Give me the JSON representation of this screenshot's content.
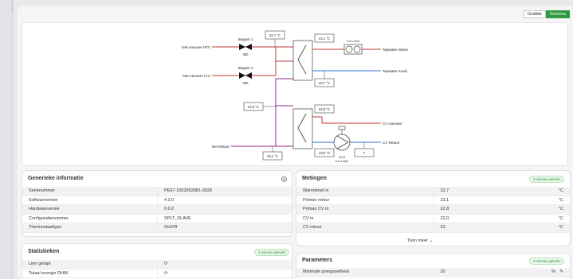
{
  "view_toggle": {
    "graph_label": "Grafiek",
    "schema_label": "Schema"
  },
  "schema": {
    "labels": {
      "net_aanvoer_htv": "Net Aanvoer HTV",
      "net_aanvoer_ltv": "Net Aanvoer LTV",
      "net_retour": "Net Retour",
      "stepper1": "Stepper 1",
      "stepper1_val": "400",
      "stepper2": "Stepper 2",
      "stepper2_val": "400",
      "tapwater_warm": "Tapwater Warm",
      "tapwater_koud": "Tapwater Koud",
      "cv_aanvoer": "CV Aanvoer",
      "cv_retour": "CV Retour",
      "flow_dhw": "0.0 L/min",
      "pump_flow_a": "10,0",
      "pump_flow_b": "0.0 L/min",
      "unknown": "?"
    },
    "temps": {
      "top_in": "22,7 °C",
      "tap_warm": "22,1 °C",
      "tap_cold": "22,7 °C",
      "mid_left": "22,8 °C",
      "cv_supply": "22,8 °C",
      "pump_temp": "23,0 °C",
      "bottom": "23,1 °C"
    }
  },
  "generic_info": {
    "title": "Generieke informatie",
    "rows": [
      {
        "key": "Serienummer",
        "value": "PE67-1003052881-0029"
      },
      {
        "key": "Softwareversie",
        "value": "4.3.0"
      },
      {
        "key": "Hardwareversie",
        "value": "0.0.2"
      },
      {
        "key": "Configuratienummer",
        "value": "SPLT_SLAVE"
      },
      {
        "key": "Thermostaattype",
        "value": "On/Off"
      }
    ]
  },
  "statistics": {
    "title": "Statistieken",
    "badge": "3 minuten geleden",
    "rows": [
      {
        "key": "Liter getapt",
        "value": "⟳"
      },
      {
        "key": "Totaal energie DHW",
        "value": "⟳"
      }
    ]
  },
  "measurements": {
    "title": "Metingen",
    "badge": "3 minuten geleden",
    "rows": [
      {
        "key": "Warmtenet in",
        "value": "22,7",
        "unit": "°C"
      },
      {
        "key": "Primair retour",
        "value": "23,1",
        "unit": "°C"
      },
      {
        "key": "Primair CV in",
        "value": "22,8",
        "unit": "°C"
      },
      {
        "key": "CV in",
        "value": "22,0",
        "unit": "°C"
      },
      {
        "key": "CV retour",
        "value": "23",
        "unit": "°C"
      }
    ],
    "more": "Toon meer"
  },
  "parameters": {
    "title": "Parameters",
    "badge": "3 minuten geleden",
    "rows": [
      {
        "key": "Minimale pompsnelheid",
        "value": "20",
        "unit": "%"
      }
    ]
  }
}
